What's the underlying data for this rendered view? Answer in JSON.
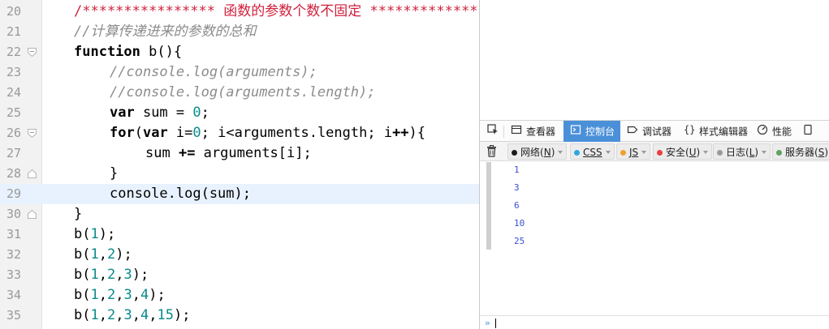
{
  "editor": {
    "current_line": 29,
    "lines": [
      {
        "n": "20",
        "indent": 1,
        "fold": "",
        "tokens": [
          {
            "t": "/****************",
            "c": "red"
          },
          {
            "t": " 函数的参数个数不固定 ",
            "c": "red"
          },
          {
            "t": "*************",
            "c": "red"
          }
        ]
      },
      {
        "n": "21",
        "indent": 1,
        "fold": "",
        "tokens": [
          {
            "t": "//计算传递进来的参数的总和",
            "c": "comment"
          }
        ]
      },
      {
        "n": "22",
        "indent": 1,
        "fold": "open",
        "tokens": [
          {
            "t": "function",
            "c": "kw"
          },
          {
            "t": " b(){",
            "c": ""
          }
        ]
      },
      {
        "n": "23",
        "indent": 2,
        "fold": "",
        "tokens": [
          {
            "t": "//console.log(arguments);",
            "c": "comment"
          }
        ]
      },
      {
        "n": "24",
        "indent": 2,
        "fold": "",
        "tokens": [
          {
            "t": "//console.log(arguments.length);",
            "c": "comment"
          }
        ]
      },
      {
        "n": "25",
        "indent": 2,
        "fold": "",
        "tokens": [
          {
            "t": "var",
            "c": "kw"
          },
          {
            "t": " sum = ",
            "c": ""
          },
          {
            "t": "0",
            "c": "num"
          },
          {
            "t": ";",
            "c": ""
          }
        ]
      },
      {
        "n": "26",
        "indent": 2,
        "fold": "open",
        "tokens": [
          {
            "t": "for",
            "c": "kw"
          },
          {
            "t": "(",
            "c": ""
          },
          {
            "t": "var",
            "c": "kw"
          },
          {
            "t": " i=",
            "c": ""
          },
          {
            "t": "0",
            "c": "num"
          },
          {
            "t": "; i<arguments.length; i",
            "c": ""
          },
          {
            "t": "++",
            "c": "kw"
          },
          {
            "t": "){",
            "c": ""
          }
        ]
      },
      {
        "n": "27",
        "indent": 3,
        "fold": "",
        "tokens": [
          {
            "t": "sum ",
            "c": ""
          },
          {
            "t": "+=",
            "c": "kw"
          },
          {
            "t": " arguments[i];",
            "c": ""
          }
        ]
      },
      {
        "n": "28",
        "indent": 2,
        "fold": "close",
        "tokens": [
          {
            "t": "}",
            "c": ""
          }
        ]
      },
      {
        "n": "29",
        "indent": 2,
        "fold": "",
        "tokens": [
          {
            "t": "console.log(sum);",
            "c": ""
          }
        ]
      },
      {
        "n": "30",
        "indent": 1,
        "fold": "close",
        "tokens": [
          {
            "t": "}",
            "c": ""
          }
        ]
      },
      {
        "n": "31",
        "indent": 1,
        "fold": "",
        "tokens": [
          {
            "t": "b(",
            "c": ""
          },
          {
            "t": "1",
            "c": "num"
          },
          {
            "t": ");",
            "c": ""
          }
        ]
      },
      {
        "n": "32",
        "indent": 1,
        "fold": "",
        "tokens": [
          {
            "t": "b(",
            "c": ""
          },
          {
            "t": "1",
            "c": "num"
          },
          {
            "t": ",",
            "c": ""
          },
          {
            "t": "2",
            "c": "num"
          },
          {
            "t": ");",
            "c": ""
          }
        ]
      },
      {
        "n": "33",
        "indent": 1,
        "fold": "",
        "tokens": [
          {
            "t": "b(",
            "c": ""
          },
          {
            "t": "1",
            "c": "num"
          },
          {
            "t": ",",
            "c": ""
          },
          {
            "t": "2",
            "c": "num"
          },
          {
            "t": ",",
            "c": ""
          },
          {
            "t": "3",
            "c": "num"
          },
          {
            "t": ");",
            "c": ""
          }
        ]
      },
      {
        "n": "34",
        "indent": 1,
        "fold": "",
        "tokens": [
          {
            "t": "b(",
            "c": ""
          },
          {
            "t": "1",
            "c": "num"
          },
          {
            "t": ",",
            "c": ""
          },
          {
            "t": "2",
            "c": "num"
          },
          {
            "t": ",",
            "c": ""
          },
          {
            "t": "3",
            "c": "num"
          },
          {
            "t": ",",
            "c": ""
          },
          {
            "t": "4",
            "c": "num"
          },
          {
            "t": ");",
            "c": ""
          }
        ]
      },
      {
        "n": "35",
        "indent": 1,
        "fold": "",
        "tokens": [
          {
            "t": "b(",
            "c": ""
          },
          {
            "t": "1",
            "c": "num"
          },
          {
            "t": ",",
            "c": ""
          },
          {
            "t": "2",
            "c": "num"
          },
          {
            "t": ",",
            "c": ""
          },
          {
            "t": "3",
            "c": "num"
          },
          {
            "t": ",",
            "c": ""
          },
          {
            "t": "4",
            "c": "num"
          },
          {
            "t": ",",
            "c": ""
          },
          {
            "t": "15",
            "c": "num"
          },
          {
            "t": ");",
            "c": ""
          }
        ]
      }
    ]
  },
  "devtools": {
    "tabs": [
      {
        "label": "",
        "icon": "element-picker-icon",
        "active": false
      },
      {
        "label": "查看器",
        "icon": "inspector-icon",
        "active": false
      },
      {
        "label": "控制台",
        "icon": "console-icon",
        "active": true
      },
      {
        "label": "调试器",
        "icon": "debugger-icon",
        "active": false
      },
      {
        "label": "样式编辑器",
        "icon": "style-editor-icon",
        "active": false
      },
      {
        "label": "性能",
        "icon": "performance-icon",
        "active": false
      },
      {
        "label": "",
        "icon": "responsive-design-icon",
        "active": false
      }
    ],
    "filters": [
      {
        "label": "网络",
        "key": "N",
        "dot_color": "#1a1a1a"
      },
      {
        "label": "CSS",
        "key": "",
        "dot_color": "#2ea7e0"
      },
      {
        "label": "JS",
        "key": "",
        "dot_color": "#f0a030"
      },
      {
        "label": "安全",
        "key": "U",
        "dot_color": "#e84040"
      },
      {
        "label": "日志",
        "key": "L",
        "dot_color": "#9a9a9a"
      },
      {
        "label": "服务器",
        "key": "S",
        "dot_color": "#5fa35f"
      }
    ],
    "trash_icon": "trash-icon",
    "output": [
      "1",
      "3",
      "6",
      "10",
      "25"
    ],
    "prompt": "»"
  },
  "colors": {
    "keyword": "#000000",
    "number": "#0b8a8a",
    "comment": "#8c8c8c",
    "banner_comment": "#d01f3c",
    "active_tab": "#4a90d9",
    "console_output": "#3b4fd6",
    "current_line": "#e8f2fe"
  }
}
